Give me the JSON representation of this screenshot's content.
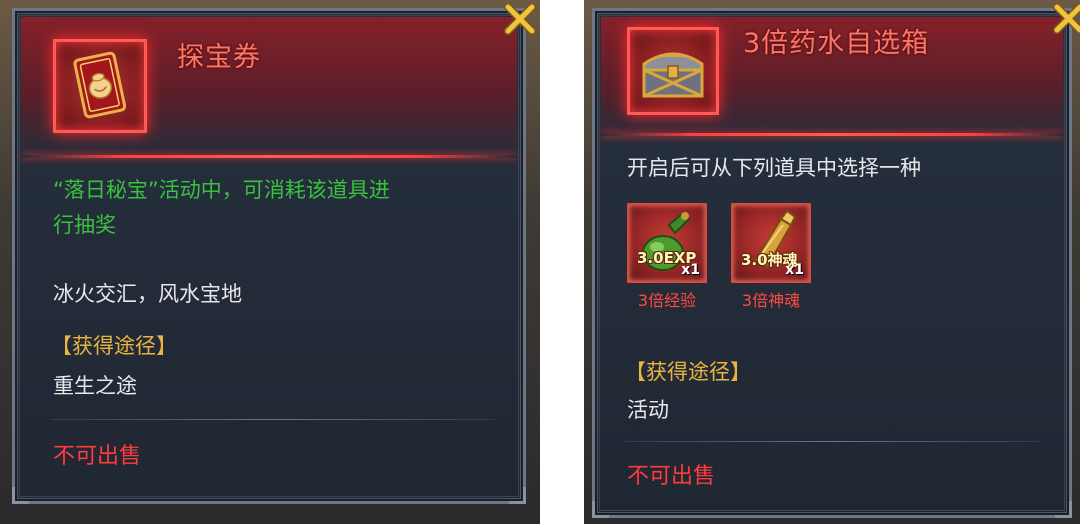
{
  "left_card": {
    "title": "探宝券",
    "description": "“落日秘宝”活动中，可消耗该道具进行抽奖",
    "description_line1": "“落日秘宝”活动中，可消耗该道具进",
    "description_line2": "行抽奖",
    "flavor": "冰火交汇，风水宝地",
    "source_header": "【获得途径】",
    "source_value": "重生之途",
    "sell_status": "不可出售",
    "icon": "red-card-icon"
  },
  "right_card": {
    "title": "3倍药水自选箱",
    "instruction": "开启后可从下列道具中选择一种",
    "items": [
      {
        "badge": "3.0EXP",
        "qty": "x1",
        "label": "3倍经验",
        "icon": "green-potion-icon"
      },
      {
        "badge": "3.0神魂",
        "qty": "x1",
        "label": "3倍神魂",
        "icon": "gold-vial-icon"
      }
    ],
    "source_header": "【获得途径】",
    "source_value": "活动",
    "sell_status": "不可出售",
    "icon": "treasure-chest-icon"
  },
  "colors": {
    "title": "#ff7565",
    "green_text": "#39c13f",
    "gold_text": "#e9b53f",
    "red_text": "#ff3b3b",
    "panel_bg": "#232b38"
  }
}
